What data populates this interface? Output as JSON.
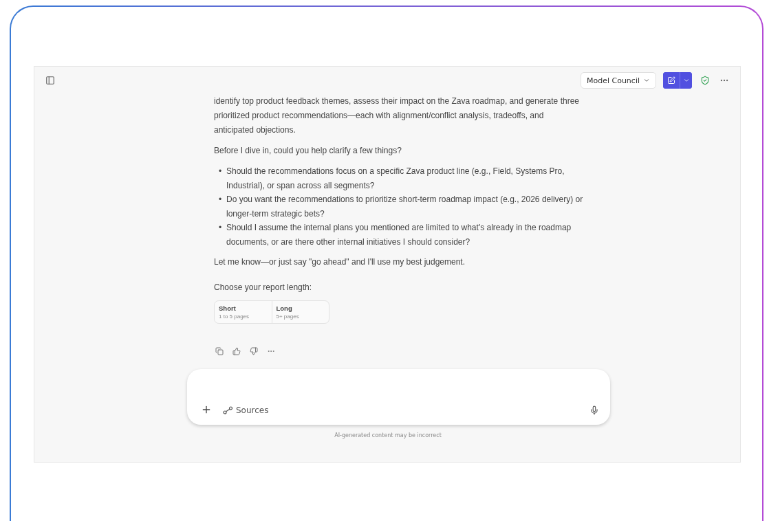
{
  "header": {
    "model_selector": "Model Council"
  },
  "message": {
    "intro": "identify top product feedback themes, assess their impact on the Zava roadmap, and generate three prioritized product recommendations—each with alignment/conflict analysis, tradeoffs, and anticipated objections.",
    "question": "Before I dive in, could you help clarify a few things?",
    "bullets": [
      {
        "marker": "•",
        "text": "Should the recommendations focus on a specific Zava product line (e.g., Field, Systems Pro, Industrial), or span across all segments?"
      },
      {
        "marker": "•",
        "text": "Do you want the recommendations to prioritize short-term roadmap impact (e.g., 2026 delivery) or longer-term strategic bets?"
      },
      {
        "marker": "•",
        "text": "Should I assume the internal plans you mentioned are limited to what's already in the roadmap documents, or are there other internal initiatives I should consider?"
      }
    ],
    "closing": "Let me know—or just say \"go ahead\" and I'll use my best judgement.",
    "choice_prompt": "Choose your report length:",
    "options": [
      {
        "title": "Short",
        "subtitle": "1 to 5 pages"
      },
      {
        "title": "Long",
        "subtitle": "5+ pages"
      }
    ]
  },
  "composer": {
    "sources_label": "Sources"
  },
  "disclaimer": "AI-generated content may be incorrect"
}
